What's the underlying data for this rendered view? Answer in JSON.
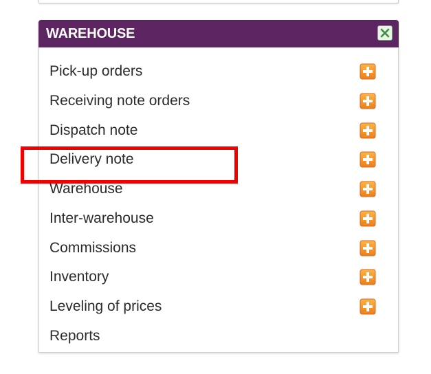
{
  "panel": {
    "title": "WAREHOUSE",
    "close_icon": "close-x-icon",
    "header_color": "#5c2461"
  },
  "menu": {
    "items": [
      {
        "label": "Pick-up orders",
        "has_add": true
      },
      {
        "label": "Receiving note orders",
        "has_add": true
      },
      {
        "label": "Dispatch note",
        "has_add": true
      },
      {
        "label": "Delivery note",
        "has_add": true
      },
      {
        "label": "Warehouse",
        "has_add": true
      },
      {
        "label": "Inter-warehouse",
        "has_add": true
      },
      {
        "label": "Commissions",
        "has_add": true
      },
      {
        "label": "Inventory",
        "has_add": true
      },
      {
        "label": "Leveling of prices",
        "has_add": true
      },
      {
        "label": "Reports",
        "has_add": false
      }
    ],
    "add_icon": "plus-add-icon",
    "add_icon_color": "#f07d18"
  },
  "annotation": {
    "highlighted_item": "Delivery note",
    "color": "#f20000"
  }
}
